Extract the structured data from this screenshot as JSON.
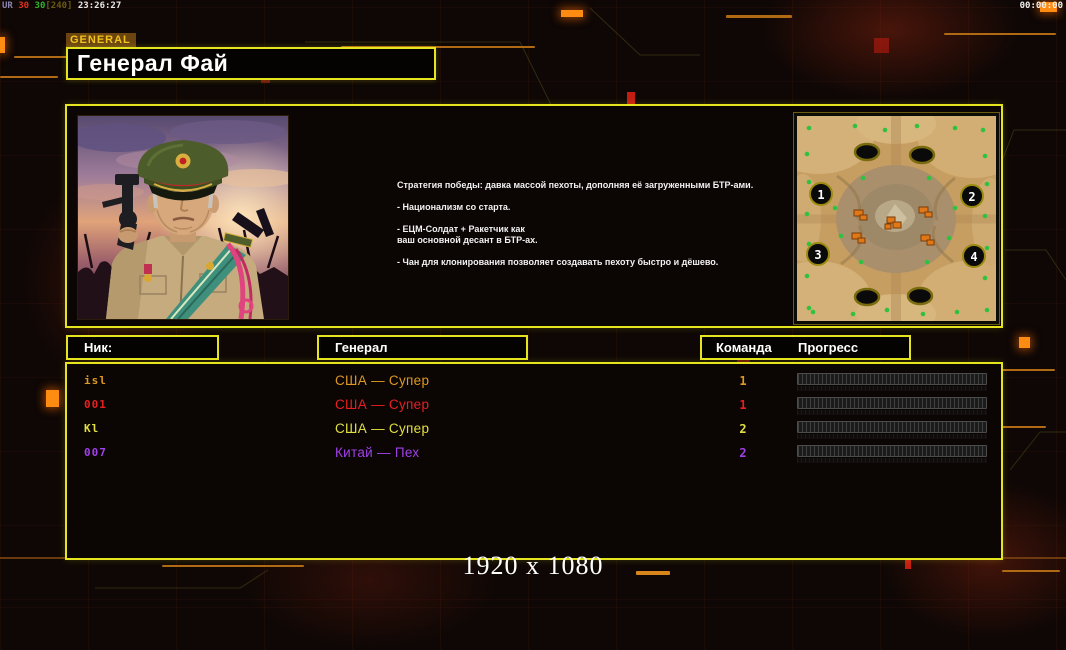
{
  "debug": {
    "prefix": "UR",
    "fps1": "30",
    "fps2": "30",
    "bracket": "[240]",
    "clock": "23:26:27",
    "timer": "00:00:00"
  },
  "header": {
    "tag": "GENERAL",
    "title": "Генерал Фай"
  },
  "info": {
    "strategy": {
      "line1": "Стратегия победы: давка массой пехоты, дополняя её загруженными БТР-ами.",
      "line2": "- Национализм со старта.",
      "line3a": "- ЕЦМ-Солдат + Ракетчик как",
      "line3b": "ваш основной десант в БТР-ах.",
      "line4": "- Чан для клонирования позволяет создавать пехоту быстро и дёшево."
    },
    "map": {
      "start_positions": [
        "1",
        "2",
        "3",
        "4"
      ]
    }
  },
  "table": {
    "headers": {
      "nick": "Ник:",
      "general": "Генерал",
      "team": "Команда",
      "progress": "Прогресс"
    },
    "rows": [
      {
        "nick": "isl",
        "general": "США — Супер",
        "team": "1",
        "color": "#dd9922"
      },
      {
        "nick": "001",
        "general": "США — Супер",
        "team": "1",
        "color": "#e62020"
      },
      {
        "nick": "Kl",
        "general": "США — Супер",
        "team": "2",
        "color": "#e0e040"
      },
      {
        "nick": "007",
        "general": "Китай — Пех",
        "team": "2",
        "color": "#a040e8"
      }
    ]
  },
  "footer": {
    "resolution": "1920 x 1080"
  },
  "colors": {
    "panel_border": "#e6e41e",
    "circuit_orange": "#b06a14",
    "map_tree_green": "#2ec23e",
    "title_text": "#ffffff"
  }
}
